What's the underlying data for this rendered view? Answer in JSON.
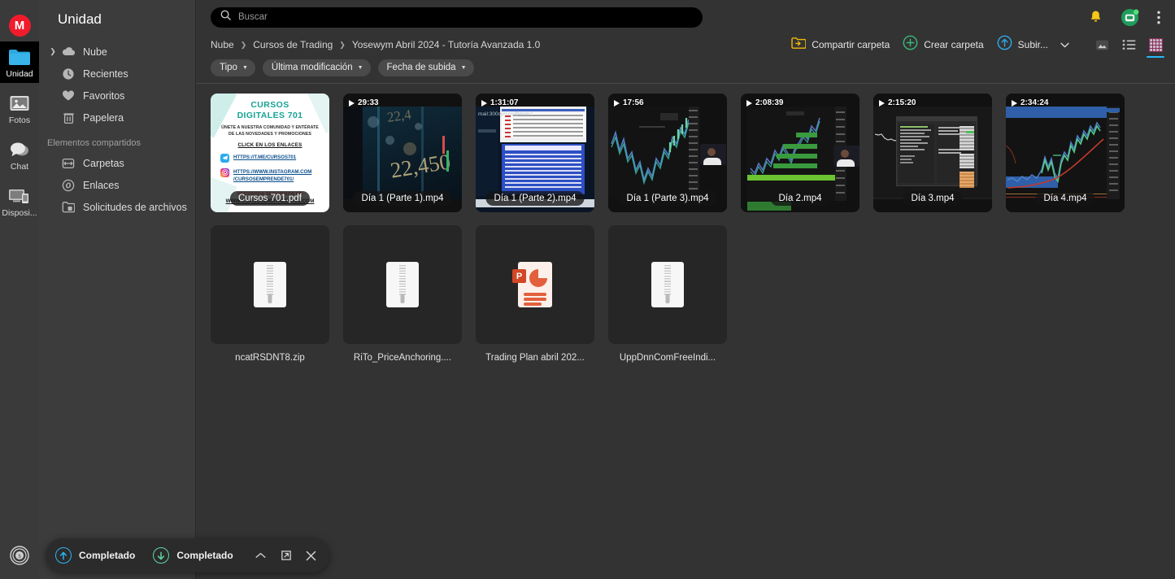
{
  "rail": {
    "logo_text": "M",
    "items": [
      {
        "label": "Unidad",
        "icon": "folder-icon",
        "active": true
      },
      {
        "label": "Fotos",
        "icon": "photos-icon",
        "active": false
      },
      {
        "label": "Chat",
        "icon": "chat-icon",
        "active": false
      },
      {
        "label": "Disposi...",
        "icon": "devices-icon",
        "active": false
      }
    ],
    "bottom_icon": "mega-badge-icon"
  },
  "sidebar": {
    "title": "Unidad",
    "items": [
      {
        "label": "Nube",
        "icon": "cloud-icon",
        "expandable": true
      },
      {
        "label": "Recientes",
        "icon": "clock-icon",
        "expandable": false
      },
      {
        "label": "Favoritos",
        "icon": "heart-icon",
        "expandable": false
      },
      {
        "label": "Papelera",
        "icon": "trash-icon",
        "expandable": false
      }
    ],
    "shared_section_label": "Elementos compartidos",
    "shared_items": [
      {
        "label": "Carpetas",
        "icon": "shared-folders-icon"
      },
      {
        "label": "Enlaces",
        "icon": "link-icon"
      },
      {
        "label": "Solicitudes de archivos",
        "icon": "file-request-icon"
      }
    ]
  },
  "search": {
    "placeholder": "Buscar",
    "value": "",
    "icon": "search-icon"
  },
  "header": {
    "notifications_icon": "bell-icon",
    "avatar_icon": "avatar-icon",
    "menu_icon": "kebab-menu-icon"
  },
  "breadcrumb": {
    "items": [
      "Nube",
      "Cursos de Trading",
      "Yosewym Abril 2024 - Tutoría Avanzada 1.0"
    ],
    "separator": "›"
  },
  "actions": {
    "share_folder": {
      "label": "Compartir carpeta",
      "icon": "share-folder-icon"
    },
    "create_folder": {
      "label": "Crear carpeta",
      "icon": "plus-circle-icon"
    },
    "upload": {
      "label": "Subir...",
      "icon": "upload-circle-icon",
      "caret": "chevron-down-icon"
    },
    "views": [
      {
        "name": "media-view-icon",
        "active": false
      },
      {
        "name": "list-view-icon",
        "active": false
      },
      {
        "name": "grid-view-icon",
        "active": true
      }
    ]
  },
  "filters": [
    {
      "label": "Tipo",
      "caret": "▾"
    },
    {
      "label": "Última modificación",
      "caret": "▾"
    },
    {
      "label": "Fecha de subida",
      "caret": "▾"
    }
  ],
  "files": {
    "row1": [
      {
        "name": "Cursos 701.pdf",
        "type": "pdf",
        "duration": null,
        "flyer": {
          "title_line1": "CURSOS",
          "title_line2": "DIGITALES 701",
          "sub_line1": "ÚNETE A NUESTRA COMUNIDAD Y ENTÉRATE",
          "sub_line2": "DE LAS NOVEDADES Y PROMOCIONES",
          "click_text": "CLICK EN LOS ENLACES",
          "link1": "HTTPS://T.ME/CURSOS701",
          "link1_icon": "telegram-icon",
          "link2_a": "HTTPS://WWW.INSTAGRAM.COM",
          "link2_b": "/CURSOSEMPRENDE701/",
          "link2_icon": "instagram-icon",
          "footer_line1": "RECUERDA SEGUIRNOS EN",
          "footer_line2": "WWW.CURSOSDIGITALES701.COM"
        }
      },
      {
        "name": "Día 1 (Parte 1).mp4",
        "type": "video",
        "duration": "29:33",
        "preview": "bokeh-chart"
      },
      {
        "name": "Día 1 (Parte 2).mp4",
        "type": "video",
        "duration": "1:31:07",
        "preview": "spreadsheet",
        "overlay_text": "mail:300cursos@mail.c"
      },
      {
        "name": "Día 1 (Parte 3).mp4",
        "type": "video",
        "duration": "17:56",
        "preview": "candles"
      },
      {
        "name": "Día 2.mp4",
        "type": "video",
        "duration": "2:08:39",
        "preview": "candles-green-levels"
      },
      {
        "name": "Día 3.mp4",
        "type": "video",
        "duration": "2:15:20",
        "preview": "platform-ui"
      },
      {
        "name": "Día 4.mp4",
        "type": "video",
        "duration": "2:34:24",
        "preview": "candles-blue-zones"
      }
    ],
    "row2": [
      {
        "name": "ncatRSDNT8.zip",
        "type": "zip"
      },
      {
        "name": "RiTo_PriceAnchoring....",
        "type": "zip"
      },
      {
        "name": "Trading Plan abril 202...",
        "type": "powerpoint"
      },
      {
        "name": "UppDnnComFreeIndi...",
        "type": "zip"
      }
    ]
  },
  "transfers": {
    "upload": {
      "label": "Completado",
      "icon": "upload-arrow-icon",
      "color": "#29b6f6"
    },
    "download": {
      "label": "Completado",
      "icon": "download-arrow-icon",
      "color": "#5fd6a2"
    },
    "collapse_icon": "chevron-up-icon",
    "popout_icon": "popout-icon",
    "close_icon": "close-icon"
  },
  "colors": {
    "accent": "#29b6f6",
    "brand_red": "#f01c2c",
    "bg_main": "#333333",
    "bg_sidebar": "#3c3c3c",
    "bg_rail": "#3a3a3a",
    "card": "#262626"
  }
}
